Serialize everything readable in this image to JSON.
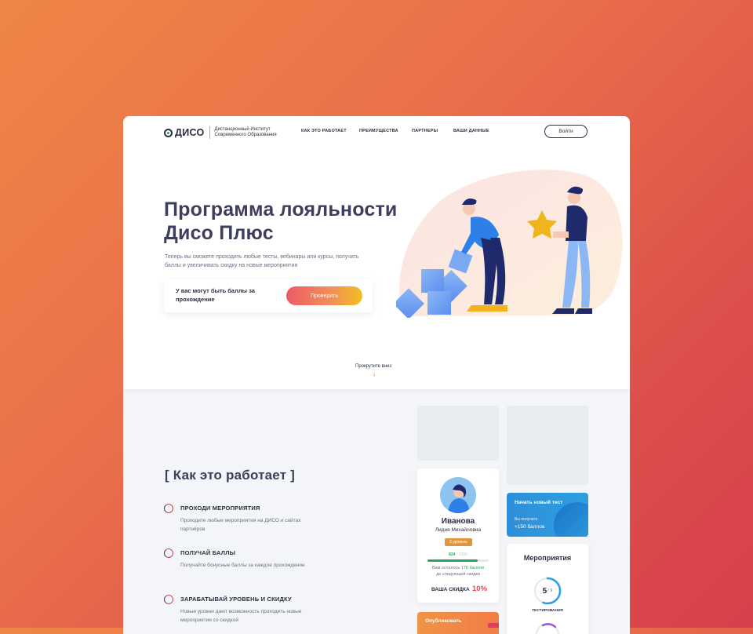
{
  "header": {
    "logo_text": "ДИСО",
    "logo_sub": "Дистанционный Институт Современного Образования",
    "nav": [
      "КАК ЭТО РАБОТАЕТ",
      "ПРЕИМУЩЕСТВА",
      "ПАРТНЕРЫ",
      "ВАШИ ДАННЫЕ"
    ],
    "login_label": "Войти"
  },
  "hero": {
    "title_line1": "Программа лояльности",
    "title_line2": "Дисо Плюс",
    "description": "Теперь вы сможете проходить любые тесты, вебинары или курсы, получать баллы и увеличивать скидку на новые мероприятия",
    "check_text": "У вас могут быть баллы за прохождение",
    "check_button": "Проверить",
    "scroll_label": "Прокрутите вниз",
    "scroll_arrow": "↓"
  },
  "how": {
    "title": "[ Как это работает ]",
    "steps": [
      {
        "title": "ПРОХОДИ МЕРОПРИЯТИЯ",
        "desc": "Проходите любые мероприятия на ДИСО и сайтах партнёров"
      },
      {
        "title": "ПОЛУЧАЙ БАЛЛЫ",
        "desc": "Получайте бонусные баллы за каждое прохождение"
      },
      {
        "title": "ЗАРАБАТЫВАЙ УРОВЕНЬ И СКИДКУ",
        "desc": "Новые уровни дают возможность проходить новые мероприятия со скидкой"
      }
    ]
  },
  "profile": {
    "last_name": "Иванова",
    "first_name": "Лидия Михайловна",
    "level": "2 уровень",
    "points": "824",
    "points_total": "/ 1000",
    "progress": 0.824,
    "remaining_prefix": "Вам осталось",
    "remaining_value": "176 баллов",
    "remaining_suffix": "до следующей скидки",
    "discount_label": "ВАША СКИДКА",
    "discount_value": "10%"
  },
  "test_card": {
    "title": "Начать новый тест",
    "sub": "Вы получите",
    "points": "+150 баллов"
  },
  "events": {
    "title": "Мероприятия",
    "count": "5",
    "total": "/ 9",
    "progress": 0.556,
    "label": "ТЕСТИРОВАНИЯ"
  },
  "publish": {
    "label": "Опубликовать"
  },
  "colors": {
    "accent_red": "#e8454f",
    "green": "#2fa35e",
    "blue": "#2c9fe0",
    "dark": "#2c2e43"
  }
}
